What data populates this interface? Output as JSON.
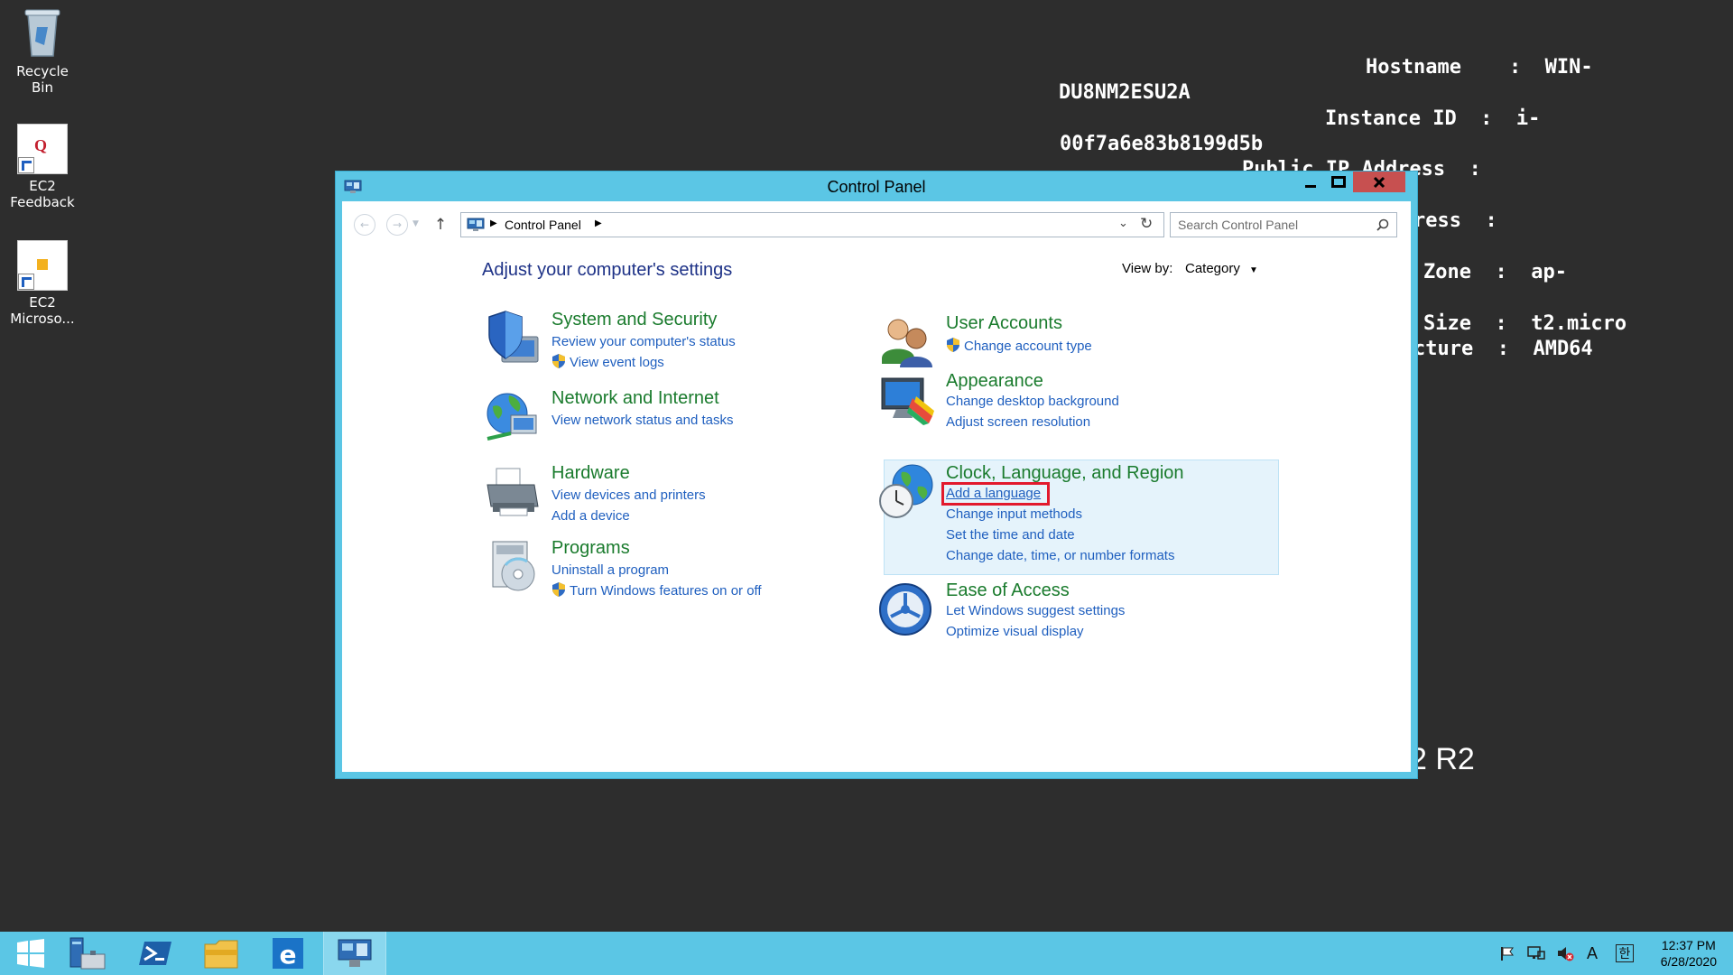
{
  "desktop": {
    "icons": [
      {
        "label": "Recycle Bin"
      },
      {
        "label": "EC2\nFeedback",
        "line1": "EC2",
        "line2": "Feedback"
      },
      {
        "label": "EC2 Microso...",
        "line1": "EC2",
        "line2": "Microso..."
      }
    ],
    "bginfo": {
      "line1": "Hostname    :  WIN-",
      "line2": "DU8NM2ESU2A",
      "line3": "Instance ID  :  i-",
      "line4": "00f7a6e83b8199d5b",
      "line5": "Public IP Address  :",
      "line6": "ress  :",
      "line7": "Zone  :  ap-",
      "line8": "Size  :  t2.micro",
      "line9": "cture  :  AMD64"
    },
    "os_name_fragment": "2 R2"
  },
  "window": {
    "title": "Control Panel",
    "address": {
      "crumb": "Control Panel"
    },
    "search": {
      "placeholder": "Search Control Panel"
    },
    "heading": "Adjust your computer's settings",
    "view_by": {
      "label": "View by:",
      "value": "Category"
    },
    "categories": [
      {
        "title": "System and Security",
        "icon": "shield-computer-icon",
        "links": [
          "Review your computer's status",
          "View event logs"
        ]
      },
      {
        "title": "Network and Internet",
        "icon": "globe-network-icon",
        "links": [
          "View network status and tasks"
        ]
      },
      {
        "title": "Hardware",
        "icon": "printer-icon",
        "links": [
          "View devices and printers",
          "Add a device"
        ]
      },
      {
        "title": "Programs",
        "icon": "programs-disc-icon",
        "links": [
          "Uninstall a program",
          "Turn Windows features on or off"
        ]
      },
      {
        "title": "User Accounts",
        "icon": "users-icon",
        "links": [
          "Change account type"
        ]
      },
      {
        "title": "Appearance",
        "icon": "monitor-paint-icon",
        "links": [
          "Change desktop background",
          "Adjust screen resolution"
        ]
      },
      {
        "title": "Clock, Language, and Region",
        "icon": "globe-clock-icon",
        "links": [
          "Add a language",
          "Change input methods",
          "Set the time and date",
          "Change date, time, or number formats"
        ]
      },
      {
        "title": "Ease of Access",
        "icon": "ease-of-access-icon",
        "links": [
          "Let Windows suggest settings",
          "Optimize visual display"
        ]
      }
    ]
  },
  "taskbar": {
    "items": [
      "start-icon",
      "server-manager-icon",
      "powershell-icon",
      "file-explorer-icon",
      "internet-explorer-icon",
      "control-panel-icon"
    ],
    "tray": {
      "ime": "A",
      "lang": "한"
    },
    "clock": {
      "time": "12:37 PM",
      "date": "6/28/2020"
    }
  },
  "colors": {
    "accent": "#5bc6e5",
    "link": "#1f5fbf",
    "category_title": "#1a7b2d",
    "heading": "#1e3287",
    "close": "#c75050",
    "highlight": "#e2192c"
  }
}
